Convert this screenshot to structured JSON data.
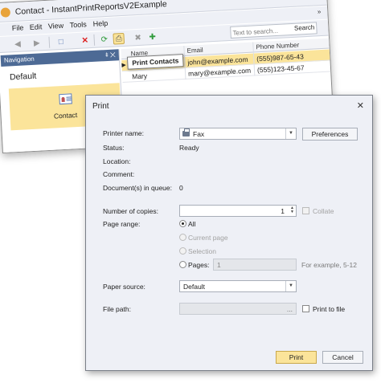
{
  "app": {
    "title": "Contact - InstantPrintReportsV2Example",
    "window_min": "–",
    "window_max": "□",
    "window_close": "✕",
    "menu": [
      "File",
      "Edit",
      "View",
      "Tools",
      "Help"
    ],
    "menu_chevron": "»",
    "search": {
      "placeholder": "Text to search...",
      "button_label": "Search"
    },
    "tooltip": "Print Contacts",
    "navigation": {
      "header": "Navigation",
      "header_buttons": "⯒ ✕",
      "group": "Default",
      "tile_label": "Contact"
    },
    "grid": {
      "columns": [
        "Name",
        "Email",
        "Phone Number"
      ],
      "rows": [
        {
          "name": "",
          "email": "john@example.com",
          "phone": "(555)987-65-43",
          "selected": true
        },
        {
          "name": "Mary",
          "email": "mary@example.com",
          "phone": "(555)123-45-67",
          "selected": false
        }
      ]
    },
    "toolbar_icons": [
      "back-icon",
      "forward-icon",
      "new-icon",
      "delete-icon",
      "refresh-icon",
      "print-icon",
      "close-icon",
      "add-icon"
    ]
  },
  "dialog": {
    "title": "Print",
    "close": "✕",
    "printer_name_label": "Printer name:",
    "printer_name": "Fax",
    "preferences_label": "Preferences",
    "status_label": "Status:",
    "status": "Ready",
    "location_label": "Location:",
    "comment_label": "Comment:",
    "queue_label": "Document(s) in queue:",
    "queue": "0",
    "copies_label": "Number of copies:",
    "copies": "1",
    "collate_label": "Collate",
    "page_range_label": "Page range:",
    "range_all": "All",
    "range_current": "Current page",
    "range_selection": "Selection",
    "range_pages": "Pages:",
    "pages_value": "1",
    "pages_hint": "For example, 5-12",
    "paper_source_label": "Paper source:",
    "paper_source": "Default",
    "file_path_label": "File path:",
    "file_path_browse": "...",
    "print_to_file_label": "Print to file",
    "print_button": "Print",
    "cancel_button": "Cancel"
  }
}
